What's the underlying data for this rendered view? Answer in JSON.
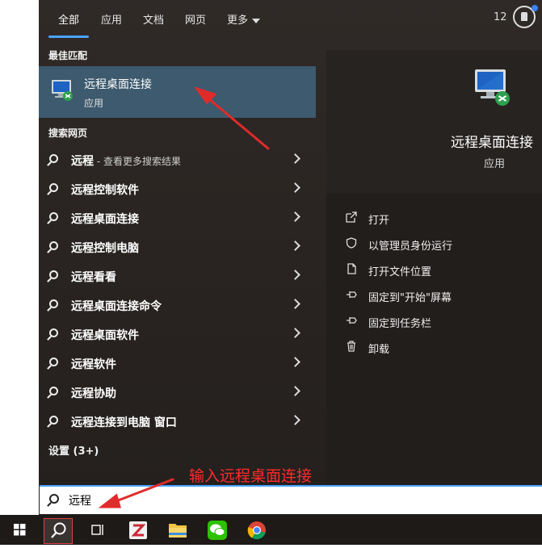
{
  "tabs": [
    {
      "label": "全部",
      "active": true
    },
    {
      "label": "应用"
    },
    {
      "label": "文档"
    },
    {
      "label": "网页"
    },
    {
      "label": "更多"
    }
  ],
  "header": {
    "count": "12"
  },
  "best_match": {
    "section_title": "最佳匹配",
    "title": "远程桌面连接",
    "subtitle": "应用"
  },
  "web_search": {
    "section_title": "搜索网页",
    "items": [
      {
        "label": "远程",
        "suffix": " - 查看更多搜索结果"
      },
      {
        "label": "远程控制软件"
      },
      {
        "label": "远程桌面连接"
      },
      {
        "label": "远程控制电脑"
      },
      {
        "label": "远程看看"
      },
      {
        "label": "远程桌面连接命令"
      },
      {
        "label": "远程桌面软件"
      },
      {
        "label": "远程软件"
      },
      {
        "label": "远程协助"
      },
      {
        "label": "远程连接到电脑 窗口"
      }
    ]
  },
  "settings": {
    "label": "设置 (3+)"
  },
  "detail": {
    "title": "远程桌面连接",
    "subtitle": "应用",
    "actions": [
      {
        "label": "打开",
        "icon": "open-icon"
      },
      {
        "label": "以管理员身份运行",
        "icon": "shield-icon"
      },
      {
        "label": "打开文件位置",
        "icon": "file-location-icon"
      },
      {
        "label": "固定到\"开始\"屏幕",
        "icon": "pin-icon"
      },
      {
        "label": "固定到任务栏",
        "icon": "pin-icon"
      },
      {
        "label": "卸载",
        "icon": "trash-icon"
      }
    ]
  },
  "search": {
    "value": "远程"
  },
  "annotation": {
    "text": "输入远程桌面连接",
    "color": "#ff2a2a"
  },
  "colors": {
    "accent": "#4aa3ff",
    "selected": "#3d5a6e"
  }
}
